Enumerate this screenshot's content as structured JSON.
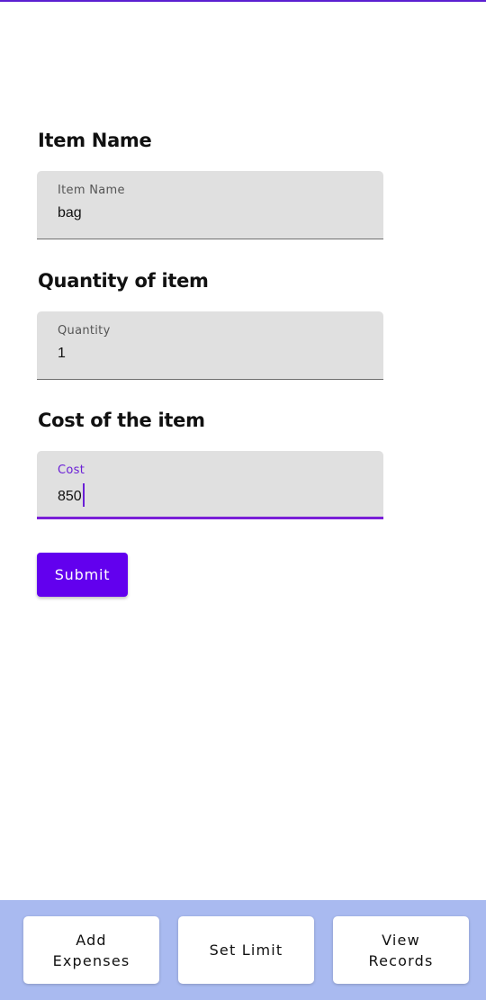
{
  "form": {
    "item_name": {
      "heading": "Item Name",
      "label": "Item Name",
      "value": "bag"
    },
    "quantity": {
      "heading": "Quantity of item",
      "label": "Quantity",
      "value": "1"
    },
    "cost": {
      "heading": "Cost of the item",
      "label": "Cost",
      "value": "850"
    },
    "submit_label": "Submit"
  },
  "bottom_nav": {
    "add_expenses": "Add\nExpenses",
    "set_limit": "Set Limit",
    "view_records": "View\nRecords"
  },
  "colors": {
    "accent": "#6200ee",
    "bottom_bar": "#a9baf0",
    "field_bg": "#e0e0e0"
  }
}
